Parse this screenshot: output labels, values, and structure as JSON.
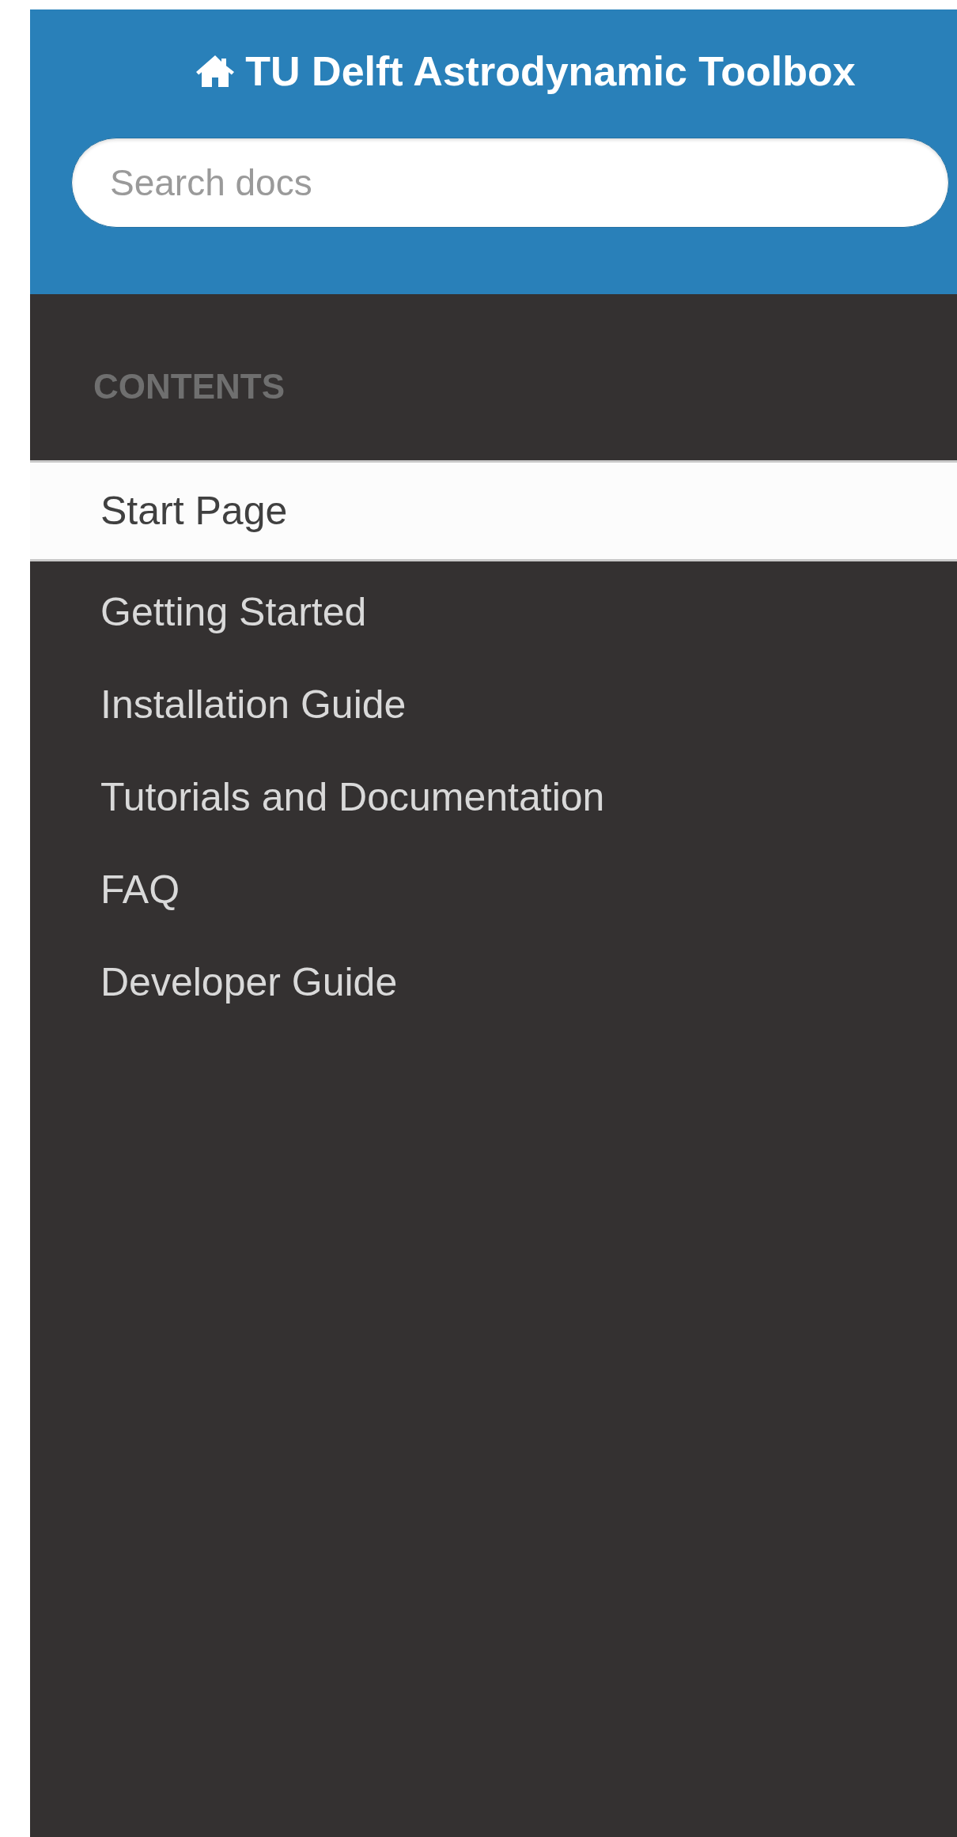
{
  "header": {
    "title": "TU Delft Astrodynamic Toolbox"
  },
  "search": {
    "placeholder": "Search docs"
  },
  "navigation": {
    "caption": "CONTENTS",
    "items": [
      {
        "label": "Start Page",
        "selected": true
      },
      {
        "label": "Getting Started",
        "selected": false
      },
      {
        "label": "Installation Guide",
        "selected": false
      },
      {
        "label": "Tutorials and Documentation",
        "selected": false
      },
      {
        "label": "FAQ",
        "selected": false
      },
      {
        "label": "Developer Guide",
        "selected": false
      }
    ]
  }
}
